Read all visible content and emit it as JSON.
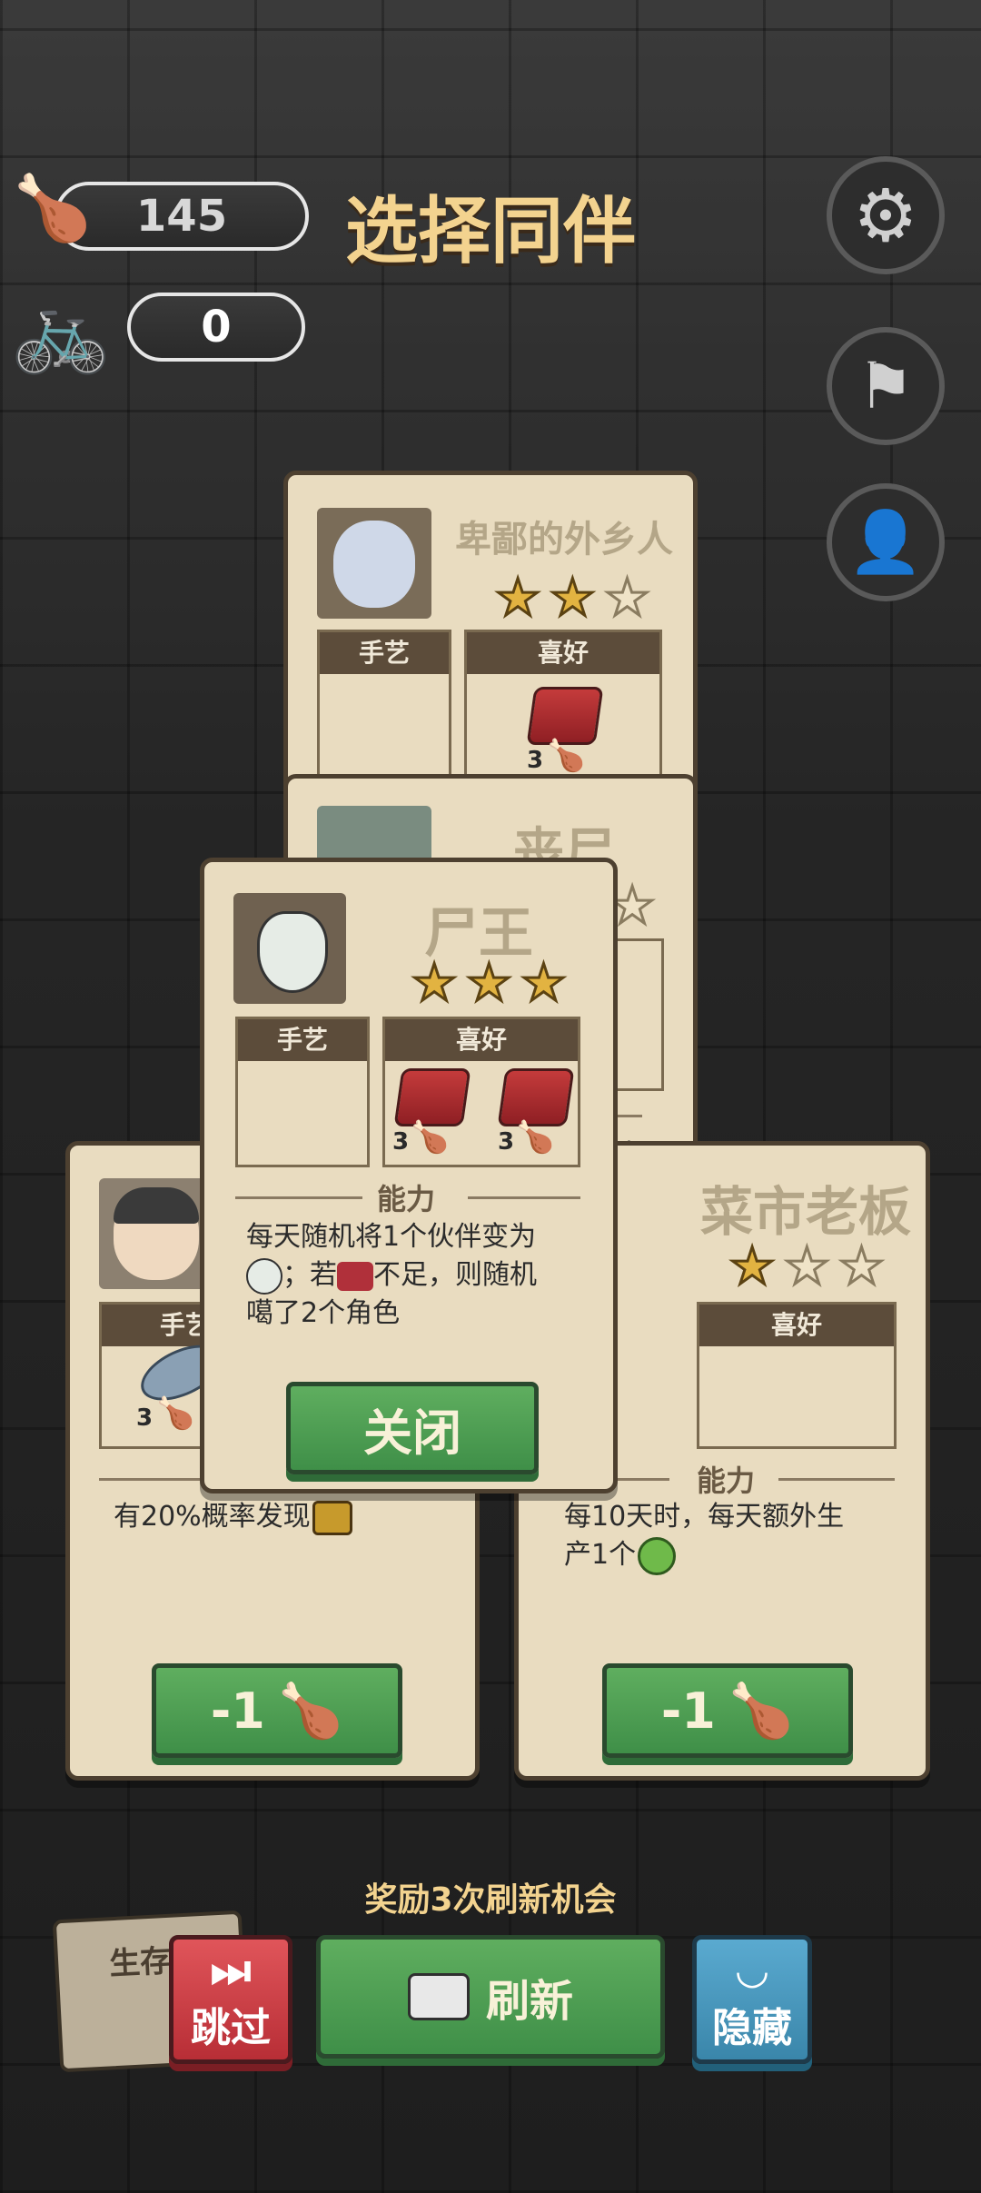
{
  "header": {
    "meat_count": "145",
    "bike_count": "0",
    "title": "选择同伴"
  },
  "icons": {
    "settings": "gear-icon",
    "flag": "flag-icon",
    "profile_search": "profile-search-icon"
  },
  "cards": {
    "back_top": {
      "name": "卑鄙的外乡人",
      "stars": 2,
      "craft_label": "手艺",
      "pref_label": "喜好",
      "pref_count": "3"
    },
    "back_middle": {
      "name": "丧尸",
      "stars": 1
    },
    "front": {
      "name": "尸王",
      "stars": 3,
      "craft_label": "手艺",
      "pref_label": "喜好",
      "pref_count_1": "3",
      "pref_count_2": "3",
      "ability_label": "能力",
      "ability_line1": "每天随机将1个伙伴变为",
      "ability_line2": "；若",
      "ability_line2b": "不足，则随机",
      "ability_line3": "噶了2个角色",
      "close_label": "关闭"
    },
    "left": {
      "craft_label": "手艺",
      "craft_count": "3",
      "ability_text": "有20%概率发现",
      "cost_label": "-1"
    },
    "right": {
      "name": "菜市老板",
      "stars": 1,
      "pref_label": "喜好",
      "ability_label": "能力",
      "ability_line1": "每10天时，每天额外生",
      "ability_line2": "产1个",
      "cost_label": "-1"
    },
    "middle_peek": {
      "line1": "为",
      "line2": "机",
      "line3": "了"
    }
  },
  "bottom": {
    "reward_text": "奖励3次刷新机会",
    "skip_label": "跳过",
    "refresh_label": "刷新",
    "hide_label": "隐藏",
    "survive_peek": "生存"
  },
  "colors": {
    "title": "#f3d38f",
    "card_bg": "#e9dcc0",
    "green": "#4f9e55",
    "red": "#c8383f",
    "blue": "#3f8fb4"
  }
}
